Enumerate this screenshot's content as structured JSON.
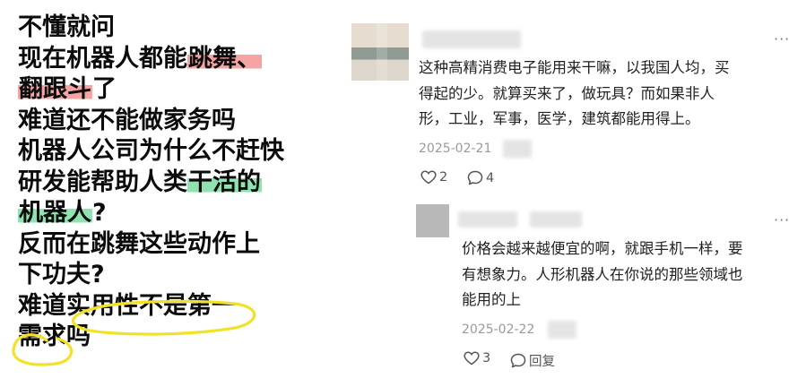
{
  "question": {
    "lines": [
      {
        "pre": "不懂就问",
        "hl": "",
        "hl_color": "",
        "post": ""
      },
      {
        "pre": "现在机器人都能",
        "hl": "跳舞、",
        "hl_color": "red",
        "post": ""
      },
      {
        "pre": "",
        "hl": "翻跟斗",
        "hl_color": "red",
        "post": "了"
      },
      {
        "pre": "难道还不能做家务吗",
        "hl": "",
        "hl_color": "",
        "post": ""
      },
      {
        "pre": "机器人公司为什么不赶快",
        "hl": "",
        "hl_color": "",
        "post": ""
      },
      {
        "pre": "研发能帮助人类",
        "hl": "干活的",
        "hl_color": "green",
        "post": ""
      },
      {
        "pre": "",
        "hl": "机器人",
        "hl_color": "green",
        "post": "?"
      },
      {
        "pre": "反而在跳舞这些动作上",
        "hl": "",
        "hl_color": "",
        "post": ""
      },
      {
        "pre": "下功夫?",
        "hl": "",
        "hl_color": "",
        "post": ""
      },
      {
        "pre": "难道实用性不是第一",
        "hl": "",
        "hl_color": "",
        "post": ""
      },
      {
        "pre": "需求吗",
        "hl": "",
        "hl_color": "",
        "post": ""
      }
    ],
    "colors": {
      "red_highlight": "#f6a3a3",
      "green_highlight": "#8fe3b0",
      "circle": "#f2e227"
    }
  },
  "comments": {
    "main": {
      "text_lines": [
        "这种高精消费电子能用来干嘛，以我国人均，买",
        "得起的少。就算买来了，做玩具？而如果非人",
        "形，工业，军事，医学，建筑都能用得上。"
      ],
      "time": "2025-02-21",
      "likes": "2",
      "replies": "4",
      "more": "···"
    },
    "reply": {
      "text_lines": [
        "价格会越来越便宜的啊，就跟手机一样，要",
        "有想象力。人形机器人在你说的那些领域也",
        "能用的上"
      ],
      "time": "2025-02-22",
      "likes": "3",
      "reply_label": "回复",
      "more": "···"
    },
    "icons": {
      "like": "heart-icon",
      "comment": "comment-bubble-icon",
      "more": "more-dots-icon"
    }
  }
}
